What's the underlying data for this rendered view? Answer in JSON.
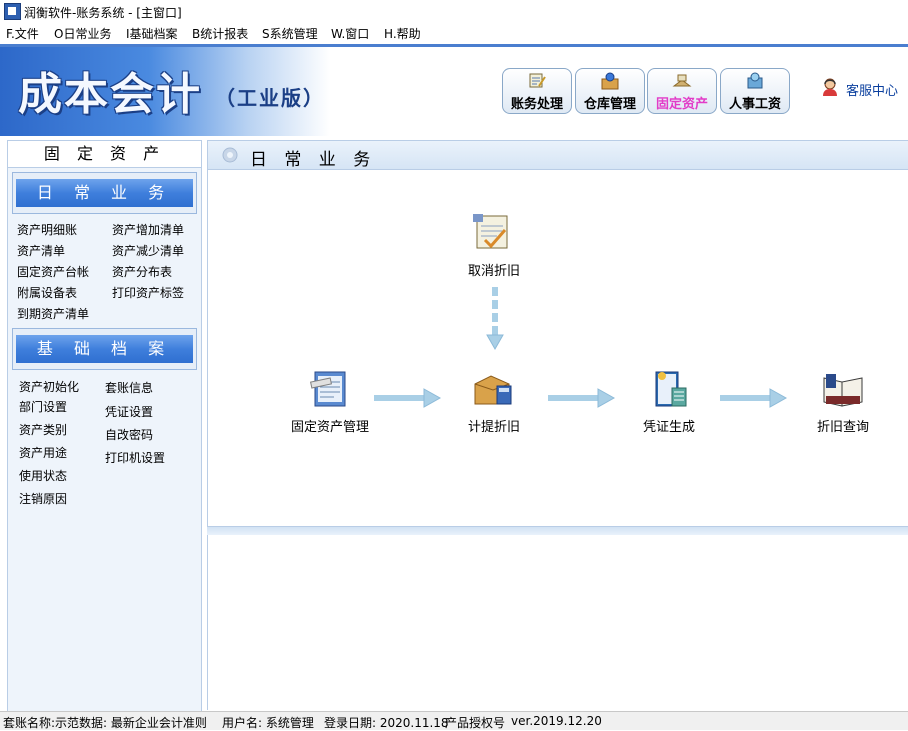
{
  "window": {
    "title": "润衡软件-账务系统 - [主窗口]"
  },
  "menu": [
    "F.文件",
    "O日常业务",
    "I基础档案",
    "B统计报表",
    "S系统管理",
    "W.窗口",
    "H.帮助"
  ],
  "header": {
    "logo": "成本会计",
    "edition": "（工业版）",
    "buttons": [
      {
        "label": "账务处理",
        "icon": "ledger-icon"
      },
      {
        "label": "仓库管理",
        "icon": "warehouse-icon"
      },
      {
        "label": "固定资产",
        "icon": "fixed-asset-icon",
        "active": true
      },
      {
        "label": "人事工资",
        "icon": "payroll-icon"
      }
    ],
    "service": "客服中心"
  },
  "sidebar": {
    "title": "固 定 资 产",
    "section1": {
      "title": "日 常 业 务",
      "left": [
        "资产明细账",
        "资产清单",
        "固定资产台帐",
        "附属设备表",
        "到期资产清单"
      ],
      "right": [
        "资产增加清单",
        "资产减少清单",
        "资产分布表",
        "打印资产标签"
      ]
    },
    "section2": {
      "title": "基 础 档 案",
      "left": [
        "资产初始化",
        "部门设置",
        "资产类别",
        "资产用途",
        "使用状态",
        "注销原因"
      ],
      "right": [
        "套账信息",
        "凭证设置",
        "自改密码",
        "打印机设置"
      ]
    }
  },
  "main": {
    "title": "日 常 业 务",
    "flow": {
      "cancel": "取消折旧",
      "asset_mgmt": "固定资产管理",
      "depreciation": "计提折旧",
      "voucher": "凭证生成",
      "query": "折旧查询"
    }
  },
  "status": {
    "book": "套账名称:示范数据: 最新企业会计准则",
    "user": "用户名: 系统管理",
    "login_date": "登录日期: 2020.11.18",
    "license": "产品授权号",
    "version": "ver.2019.12.20"
  },
  "colors": {
    "accent": "#2f6fd0",
    "active_button": "#e23cc8",
    "service": "#0a3f9e"
  }
}
